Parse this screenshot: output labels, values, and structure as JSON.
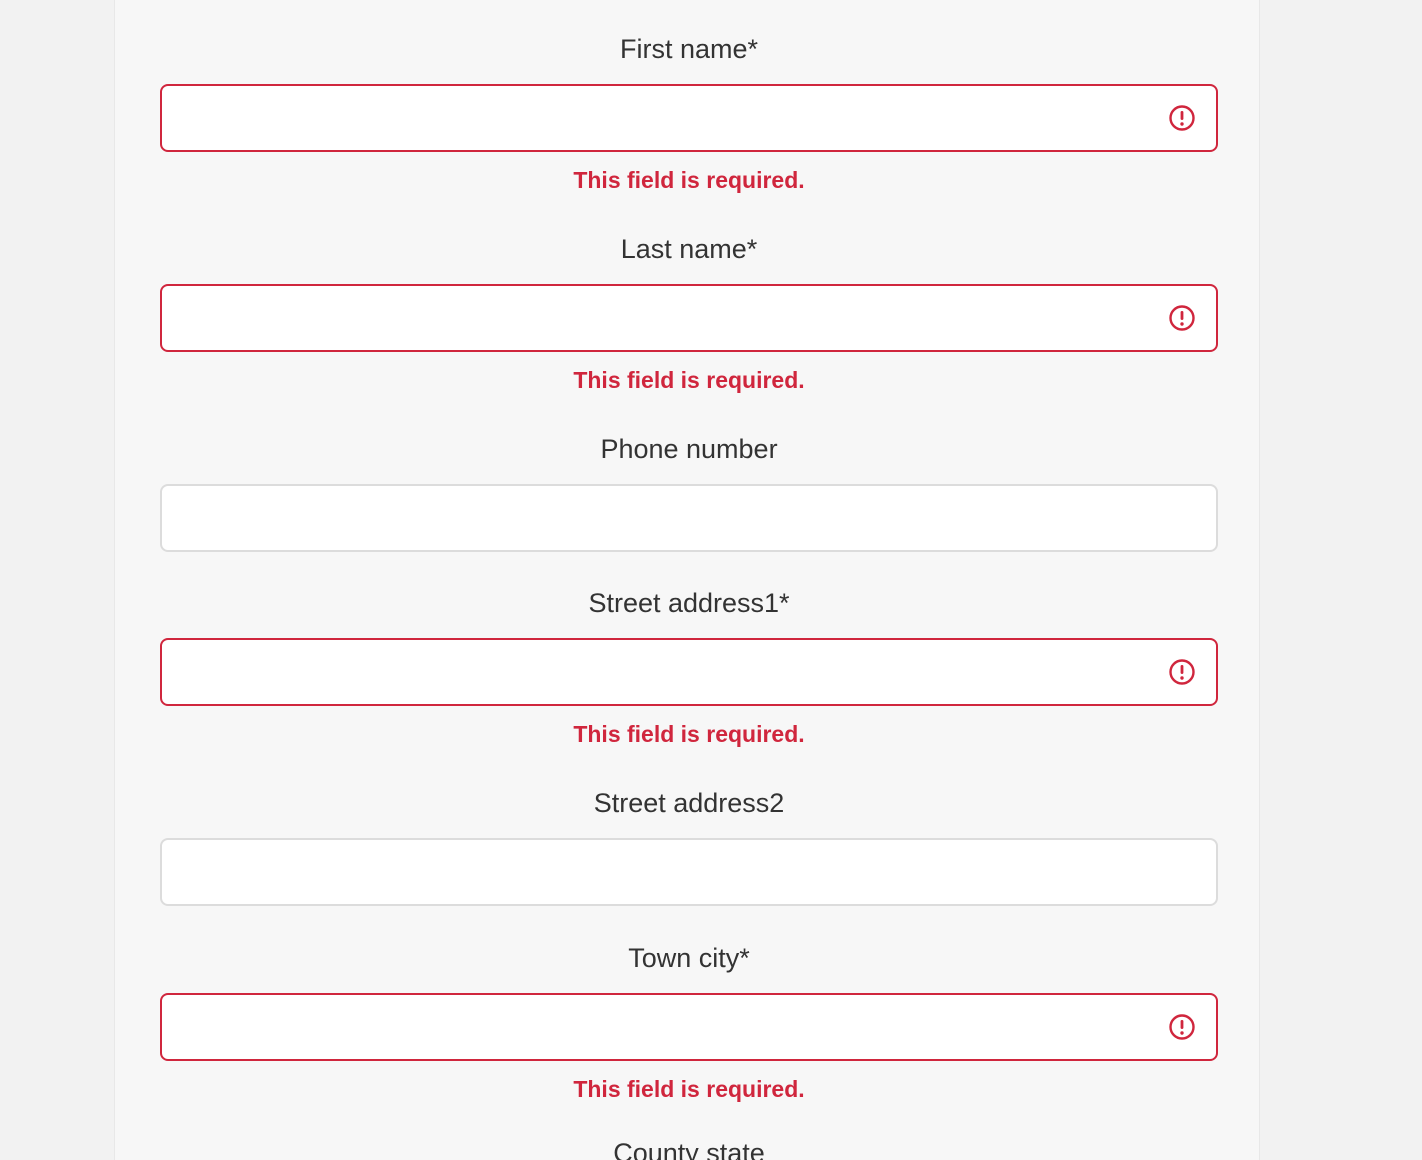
{
  "colors": {
    "error": "#d0263d",
    "label": "#333333",
    "border_default": "#dcdcdc",
    "card_bg": "#f7f7f7"
  },
  "form": {
    "fields": [
      {
        "label": "First name*",
        "value": "",
        "error": "This field is required.",
        "icon": "alert-circle-icon"
      },
      {
        "label": "Last name*",
        "value": "",
        "error": "This field is required.",
        "icon": "alert-circle-icon"
      },
      {
        "label": "Phone number",
        "value": ""
      },
      {
        "label": "Street address1*",
        "value": "",
        "error": "This field is required.",
        "icon": "alert-circle-icon"
      },
      {
        "label": "Street address2",
        "value": ""
      },
      {
        "label": "Town city*",
        "value": "",
        "error": "This field is required.",
        "icon": "alert-circle-icon"
      },
      {
        "label": "County state"
      }
    ]
  }
}
